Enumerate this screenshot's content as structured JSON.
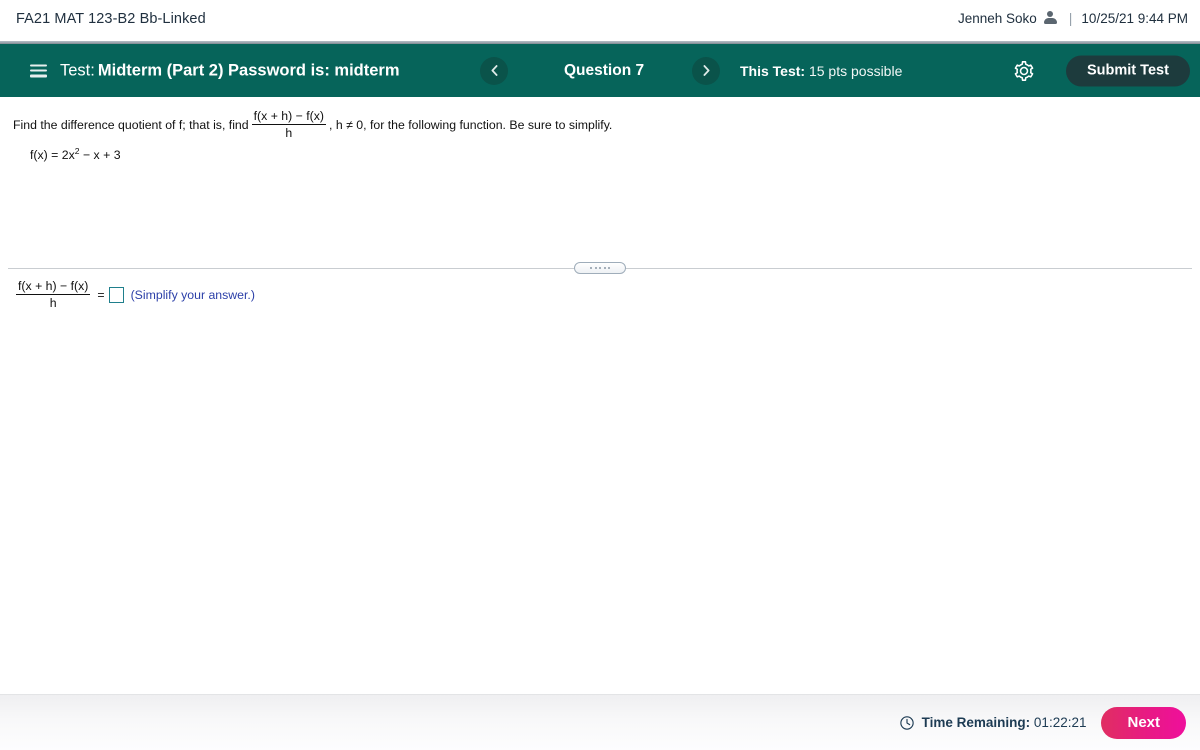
{
  "topbar": {
    "course_title": "FA21 MAT 123-B2 Bb-Linked",
    "user_name": "Jenneh Soko",
    "separator": "|",
    "timestamp": "10/25/21 9:44 PM",
    "person_icon": "person-icon"
  },
  "navbar": {
    "menu_icon": "hamburger-menu-icon",
    "test_prefix": "Test:",
    "test_name": "Midterm (Part 2) Password is: midterm",
    "prev_icon": "chevron-left-icon",
    "next_icon": "chevron-right-icon",
    "question_label": "Question 7",
    "points_prefix": "This Test:",
    "points_value": "15 pts possible",
    "gear_icon": "gear-icon",
    "submit_label": "Submit Test",
    "bg_color": "#06645a",
    "submit_bg_color": "#1d3b3d"
  },
  "question": {
    "prompt_part1": "Find the difference quotient of f; that is, find",
    "fraction_numerator": "f(x + h) − f(x)",
    "fraction_denominator": "h",
    "prompt_part2": ", h ≠ 0, for the following function.  Be sure to simplify.",
    "function_base": "f(x) = 2x",
    "function_exponent": "2",
    "function_rest": " − x + 3",
    "grabber_icon": "resize-handle-icon"
  },
  "answer": {
    "fraction_numerator": "f(x + h) − f(x)",
    "fraction_denominator": "h",
    "equals": "=",
    "input_value": "",
    "input_placeholder": "",
    "hint": "(Simplify your answer.)",
    "hint_color": "#2b3fa8",
    "input_border_color": "#1f7f8c"
  },
  "footer": {
    "clock_icon": "clock-icon",
    "time_label": "Time Remaining:",
    "time_value": "01:22:21",
    "next_label": "Next",
    "next_color_start": "#e02e62",
    "next_color_end": "#ef0f9c"
  }
}
